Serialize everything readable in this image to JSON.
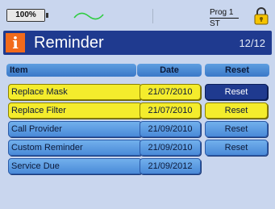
{
  "status": {
    "battery": "100%",
    "program_line1": "Prog 1",
    "program_line2": "ST"
  },
  "header": {
    "title": "Reminder",
    "count": "12/12"
  },
  "columns": {
    "item": "Item",
    "date": "Date",
    "reset": "Reset"
  },
  "rows": [
    {
      "name": "Replace Mask",
      "date": "21/07/2010",
      "reset": "Reset",
      "state": "highlighted-selected"
    },
    {
      "name": "Replace Filter",
      "date": "21/07/2010",
      "reset": "Reset",
      "state": "highlighted"
    },
    {
      "name": "Call Provider",
      "date": "21/09/2010",
      "reset": "Reset",
      "state": "normal"
    },
    {
      "name": "Custom Reminder",
      "date": "21/09/2010",
      "reset": "Reset",
      "state": "normal"
    },
    {
      "name": "Service Due",
      "date": "21/09/2012",
      "reset": null,
      "state": "normal"
    }
  ],
  "colors": {
    "background": "#c9d6ee",
    "header": "#1f3a8f",
    "info_badge": "#f26a1b",
    "highlight": "#f4ec2c",
    "row": "#5a9be0",
    "selected_button": "#1f3a8f"
  },
  "icons": {
    "battery": "battery-icon",
    "signal": "waveform-icon",
    "lock": "padlock-icon",
    "info": "info-icon"
  }
}
